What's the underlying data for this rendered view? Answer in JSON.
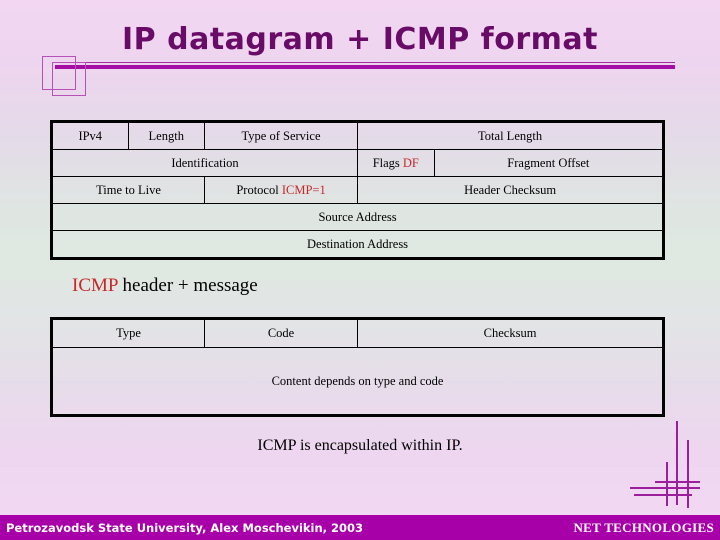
{
  "slide": {
    "title": "IP datagram + ICMP format",
    "caption": "ICMP is encapsulated within IP.",
    "accent_purple": "#680C68",
    "rule_purple": "#a40ea4",
    "footer_magenta": "#a800a8",
    "highlight_red": "#c62828"
  },
  "ip_table": {
    "rows": [
      {
        "cells": [
          {
            "label": "IPv4",
            "colspan": 2
          },
          {
            "label": "Length",
            "colspan": 2
          },
          {
            "label": "Type of Service",
            "colspan": 4
          },
          {
            "label": "Total Length",
            "colspan": 8
          }
        ]
      },
      {
        "cells": [
          {
            "label": "Identification",
            "colspan": 8
          },
          {
            "label": "Flags ",
            "red": "DF",
            "colspan": 2
          },
          {
            "label": "Fragment Offset",
            "colspan": 6
          }
        ]
      },
      {
        "cells": [
          {
            "label": "Time to Live",
            "colspan": 4
          },
          {
            "label": "Protocol ",
            "red": "ICMP=1",
            "colspan": 4
          },
          {
            "label": "Header Checksum",
            "colspan": 8
          }
        ]
      },
      {
        "cells": [
          {
            "label": "Source Address",
            "colspan": 16
          }
        ]
      },
      {
        "cells": [
          {
            "label": "Destination Address",
            "colspan": 16
          }
        ]
      }
    ]
  },
  "icmp_heading": {
    "red_part": "ICMP",
    "rest": " header + message"
  },
  "icmp_table": {
    "header_cells": [
      "Type",
      "Code",
      "Checksum"
    ],
    "body_cell": "Content depends on type and code"
  },
  "footer": {
    "left": "Petrozavodsk State University, Alex Moschevikin, 2003",
    "right": "NET TECHNOLOGIES"
  }
}
